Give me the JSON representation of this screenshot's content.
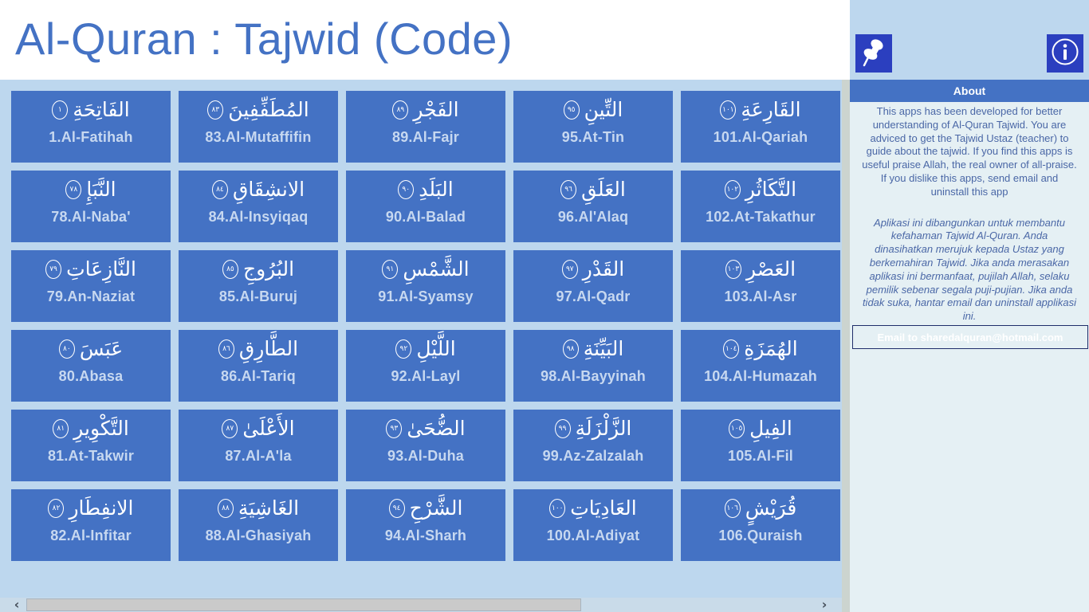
{
  "app": {
    "title": "Al-Quran : Tajwid (Code)"
  },
  "toolbar": {
    "pin_icon": "pushpin-icon",
    "info_icon": "info-icon"
  },
  "colors": {
    "accent": "#4472c4",
    "tile": "#4472c4",
    "button": "#2b3fbf",
    "background": "#bdd7ee",
    "panel": "#e5f0f4"
  },
  "surahs": [
    {
      "arabic": "الفَاتِحَةِ",
      "number_ar": "١",
      "label": "1.Al-Fatihah"
    },
    {
      "arabic": "المُطَفِّفِينَ",
      "number_ar": "٨٣",
      "label": "83.Al-Mutaffifin"
    },
    {
      "arabic": "الفَجْرِ",
      "number_ar": "٨٩",
      "label": "89.Al-Fajr"
    },
    {
      "arabic": "التِّينِ",
      "number_ar": "٩٥",
      "label": "95.At-Tin"
    },
    {
      "arabic": "القَارِعَةِ",
      "number_ar": "١٠١",
      "label": "101.Al-Qariah"
    },
    {
      "arabic": "النَّبَإِ",
      "number_ar": "٧٨",
      "label": "78.Al-Naba'"
    },
    {
      "arabic": "الانشِقَاقِ",
      "number_ar": "٨٤",
      "label": "84.Al-Insyiqaq"
    },
    {
      "arabic": "البَلَدِ",
      "number_ar": "٩٠",
      "label": "90.Al-Balad"
    },
    {
      "arabic": "العَلَقِ",
      "number_ar": "٩٦",
      "label": "96.Al'Alaq"
    },
    {
      "arabic": "التَّكَاثُرِ",
      "number_ar": "١٠٢",
      "label": "102.At-Takathur"
    },
    {
      "arabic": "النَّازِعَاتِ",
      "number_ar": "٧٩",
      "label": "79.An-Naziat"
    },
    {
      "arabic": "البُرُوجِ",
      "number_ar": "٨٥",
      "label": "85.Al-Buruj"
    },
    {
      "arabic": "الشَّمْسِ",
      "number_ar": "٩١",
      "label": "91.Al-Syamsy"
    },
    {
      "arabic": "القَدْرِ",
      "number_ar": "٩٧",
      "label": "97.Al-Qadr"
    },
    {
      "arabic": "العَصْرِ",
      "number_ar": "١٠٣",
      "label": "103.Al-Asr"
    },
    {
      "arabic": "عَبَسَ",
      "number_ar": "٨٠",
      "label": "80.Abasa"
    },
    {
      "arabic": "الطَّارِقِ",
      "number_ar": "٨٦",
      "label": "86.Al-Tariq"
    },
    {
      "arabic": "اللَّيْلِ",
      "number_ar": "٩٢",
      "label": "92.Al-Layl"
    },
    {
      "arabic": "البَيِّنَةِ",
      "number_ar": "٩٨",
      "label": "98.Al-Bayyinah"
    },
    {
      "arabic": "الهُمَزَةِ",
      "number_ar": "١٠٤",
      "label": "104.Al-Humazah"
    },
    {
      "arabic": "التَّكْوِيرِ",
      "number_ar": "٨١",
      "label": "81.At-Takwir"
    },
    {
      "arabic": "الأَعْلَىٰ",
      "number_ar": "٨٧",
      "label": "87.Al-A'la"
    },
    {
      "arabic": "الضُّحَىٰ",
      "number_ar": "٩٣",
      "label": "93.Al-Duha"
    },
    {
      "arabic": "الزَّلْزَلَةِ",
      "number_ar": "٩٩",
      "label": "99.Az-Zalzalah"
    },
    {
      "arabic": "الفِيلِ",
      "number_ar": "١٠٥",
      "label": "105.Al-Fil"
    },
    {
      "arabic": "الانفِطَارِ",
      "number_ar": "٨٢",
      "label": "82.Al-Infitar"
    },
    {
      "arabic": "الغَاشِيَةِ",
      "number_ar": "٨٨",
      "label": "88.Al-Ghasiyah"
    },
    {
      "arabic": "الشَّرْحِ",
      "number_ar": "٩٤",
      "label": "94.Al-Sharh"
    },
    {
      "arabic": "العَادِيَاتِ",
      "number_ar": "١٠٠",
      "label": "100.Al-Adiyat"
    },
    {
      "arabic": "قُرَيْشٍ",
      "number_ar": "١٠٦",
      "label": "106.Quraish"
    }
  ],
  "about": {
    "heading": "About",
    "english": "This apps has been developed for better understanding of Al-Quran Tajwid. You are adviced to get the Tajwid Ustaz (teacher) to guide about the tajwid. If you find this apps is useful praise Allah, the real owner of all-praise. If you dislike this apps, send email and uninstall this app",
    "malay": "Aplikasi ini dibangunkan untuk membantu kefahaman Tajwid Al-Quran. Anda dinasihatkan merujuk kepada Ustaz yang berkemahiran Tajwid. Jika anda merasakan aplikasi ini bermanfaat, pujilah Allah, selaku pemilik sebenar segala puji-pujian. Jika anda tidak suka, hantar email dan uninstall applikasi ini.",
    "email_placeholder": "Email to sharedalquran@hotmail.com",
    "email_value": ""
  },
  "scrollbar": {
    "left_arrow": "‹",
    "right_arrow": "›"
  }
}
